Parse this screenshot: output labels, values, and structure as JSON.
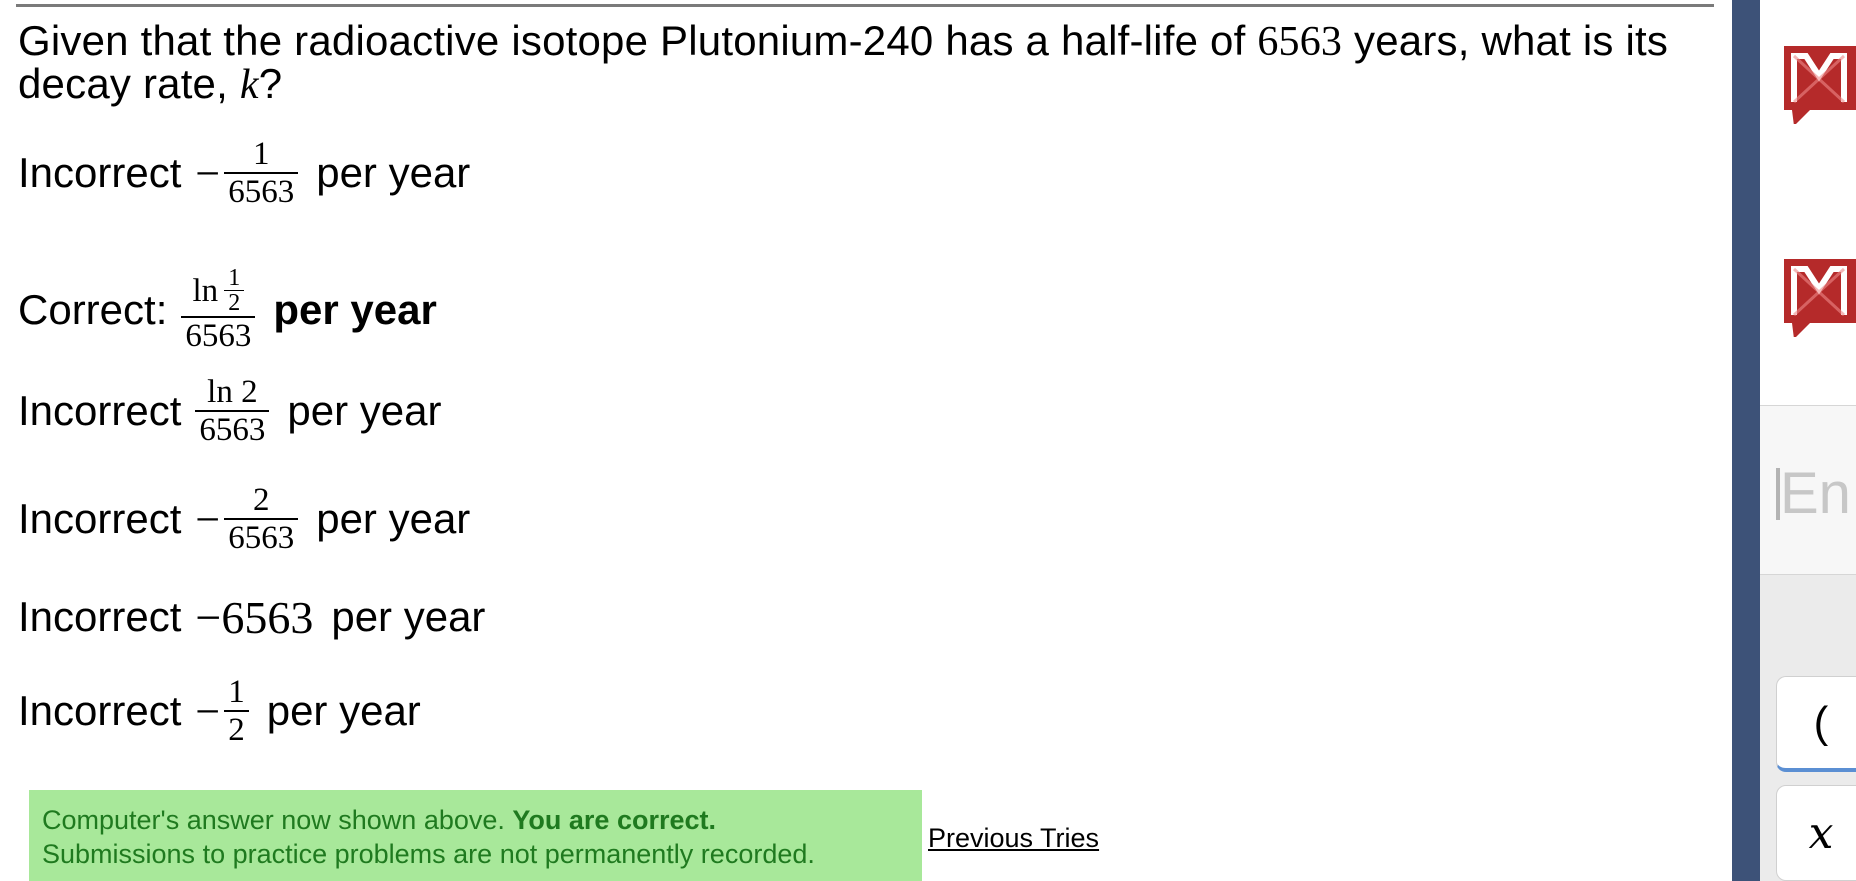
{
  "question": {
    "part1": "Given that the radioactive isotope Plutonium-240 has a half-life of",
    "half_life": "6563",
    "part2": "years, what is its decay rate,",
    "variable": "k",
    "end": "?"
  },
  "options": [
    {
      "status": "Incorrect",
      "neg": "−",
      "numerator": "1",
      "denominator": "6563",
      "unit": "per year"
    },
    {
      "status": "Correct:",
      "ln": "ln",
      "inner_num": "1",
      "inner_den": "2",
      "denominator": "6563",
      "unit": "per year"
    },
    {
      "status": "Incorrect",
      "numerator": "ln 2",
      "denominator": "6563",
      "unit": "per year"
    },
    {
      "status": "Incorrect",
      "neg": "−",
      "numerator": "2",
      "denominator": "6563",
      "unit": "per year"
    },
    {
      "status": "Incorrect",
      "value": "−6563",
      "unit": "per year"
    },
    {
      "status": "Incorrect",
      "neg": "−",
      "numerator": "1",
      "denominator": "2",
      "unit": "per year"
    }
  ],
  "feedback": {
    "line1_prefix": "Computer's answer now shown above.",
    "line1_bold": "You are correct.",
    "line2": "Submissions to practice problems are not permanently recorded."
  },
  "previous_tries": "Previous Tries",
  "sidebar": {
    "en_text": "En",
    "key_paren": "(",
    "key_x": "x"
  },
  "colors": {
    "feedback_bg": "#a8e89a",
    "feedback_text": "#1f7a1f",
    "divider": "#3d5278",
    "logo_red": "#b52a2a"
  },
  "icons": [
    "maplesoft-m-logo-icon",
    "maplesoft-m-logo-icon"
  ]
}
